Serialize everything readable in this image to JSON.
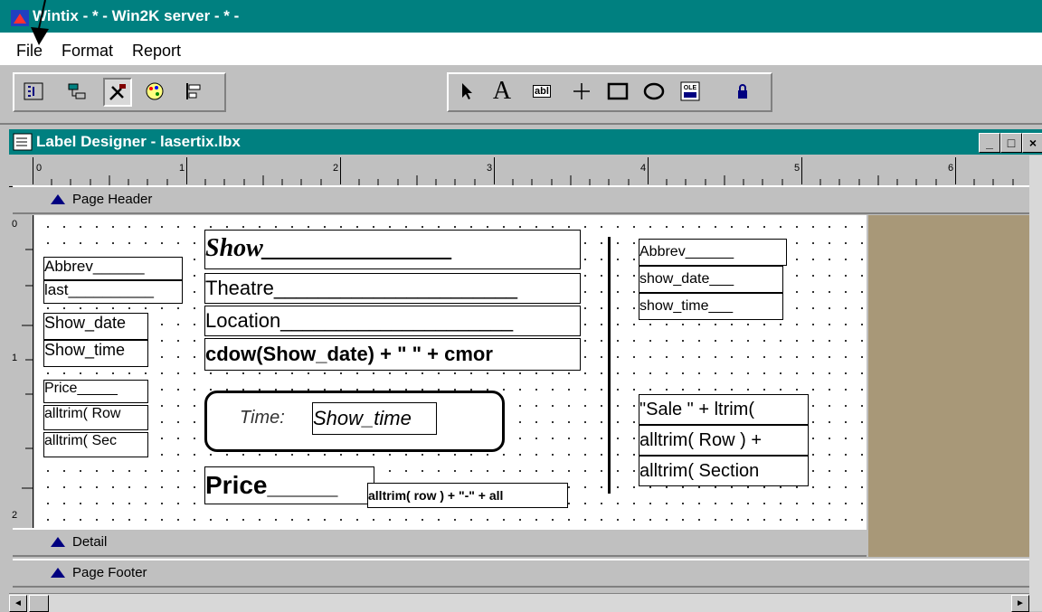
{
  "app": {
    "title": "Wintix - * - Win2K server - * -"
  },
  "menu": [
    {
      "label": "File"
    },
    {
      "label": "Format"
    },
    {
      "label": "Report"
    }
  ],
  "toolbar": {
    "left_icons": [
      "layout-icon",
      "tree-icon",
      "tools-icon",
      "palette-icon",
      "align-icon"
    ],
    "right_icons": [
      "pointer-icon",
      "text-label-icon",
      "field-icon",
      "line-icon",
      "rectangle-icon",
      "ellipse-icon",
      "ole-icon",
      "lock-icon"
    ],
    "text_label_glyph": "A",
    "field_glyph": "abl",
    "ole_glyph": "OLE"
  },
  "designer": {
    "title": "Label Designer - lasertix.lbx",
    "minimize": "_",
    "maximize": "□",
    "close": "×"
  },
  "ruler": {
    "numbers": [
      "0",
      "1",
      "2",
      "3",
      "4",
      "5",
      "6"
    ]
  },
  "vruler": {
    "numbers": [
      "0",
      "1",
      "2"
    ]
  },
  "bands": {
    "page_header": "Page Header",
    "detail": "Detail",
    "page_footer": "Page Footer"
  },
  "fields": {
    "abbrev_left": "Abbrev______",
    "last": "last__________",
    "show_date_left": "Show_date",
    "show_time_left": "Show_time",
    "price_small": "Price_____",
    "alltrim_row_left": "alltrim( Row",
    "alltrim_sec_left": "alltrim( Sec",
    "show": "Show_______________",
    "theatre": "Theatre______________________",
    "location": "Location_____________________",
    "cdow": "cdow(Show_date) + \" \" + cmor",
    "time_label": "Time:",
    "show_time_mid": "Show_time",
    "price_big": "Price_____",
    "alltrim_row_mid": "alltrim( row ) + \"-\" + all",
    "abbrev_right": "Abbrev______",
    "show_date_right": "show_date___",
    "show_time_right": "show_time___",
    "sale": "\"Sale \" + ltrim(",
    "alltrim_row_right": "alltrim( Row ) +",
    "alltrim_section_right": "alltrim( Section"
  }
}
